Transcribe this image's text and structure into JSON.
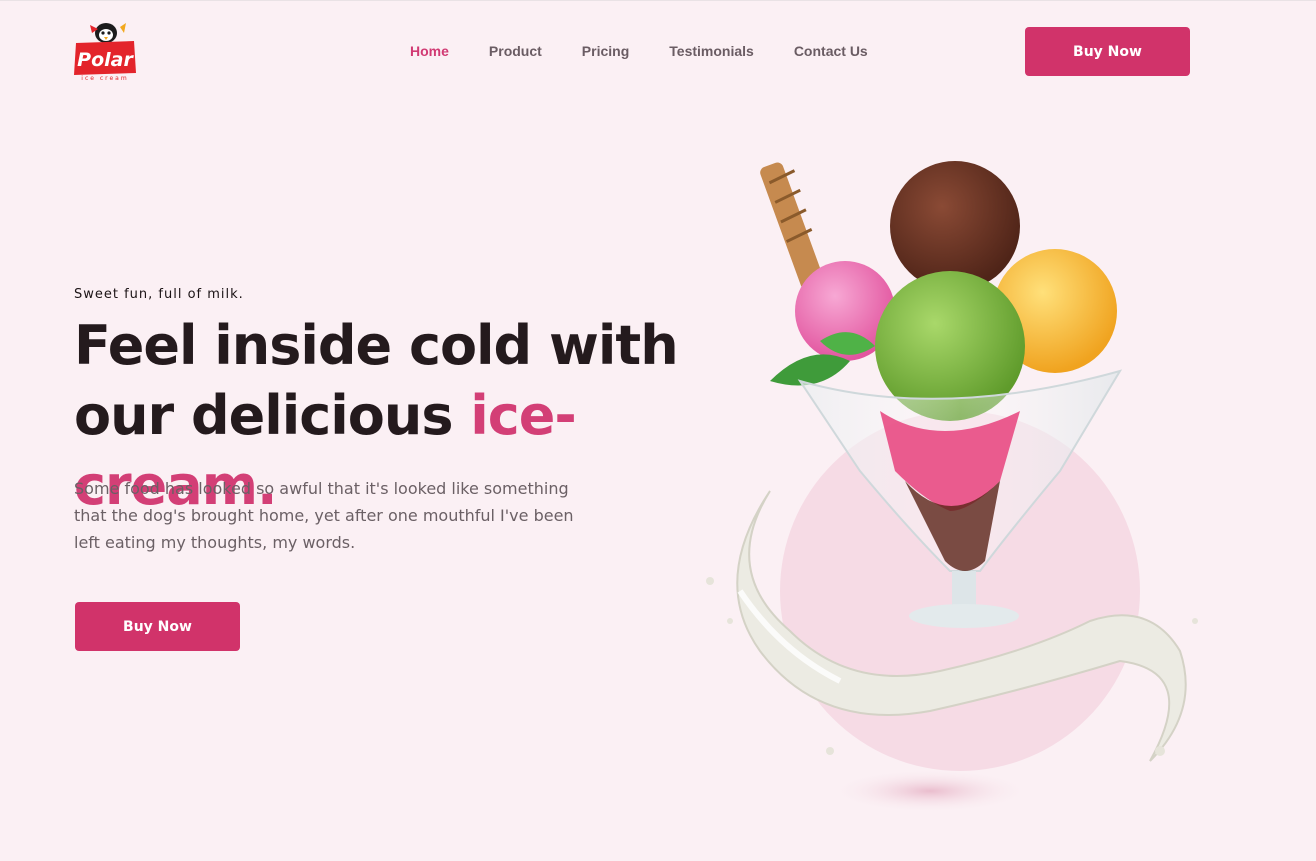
{
  "header": {
    "logo": {
      "wordmark": "Polar",
      "sub": "ice cream"
    },
    "nav": [
      {
        "label": "Home",
        "active": true
      },
      {
        "label": "Product",
        "active": false
      },
      {
        "label": "Pricing",
        "active": false
      },
      {
        "label": "Testimonials",
        "active": false
      },
      {
        "label": "Contact Us",
        "active": false
      }
    ],
    "cta_label": "Buy Now"
  },
  "hero": {
    "tagline": "Sweet fun, full of milk.",
    "headline_line1": "Feel inside cold with",
    "headline_line2": "our delicious ",
    "headline_accent": "ice-cream.",
    "description": "Some food has looked so awful that it's looked like something that the dog's brought home, yet after one mouthful I've been left eating my thoughts, my words.",
    "cta_label": "Buy Now"
  },
  "colors": {
    "background": "#fbf0f4",
    "accent": "#d1336a",
    "text_dark": "#241a1d",
    "text_muted": "#6b6065"
  }
}
